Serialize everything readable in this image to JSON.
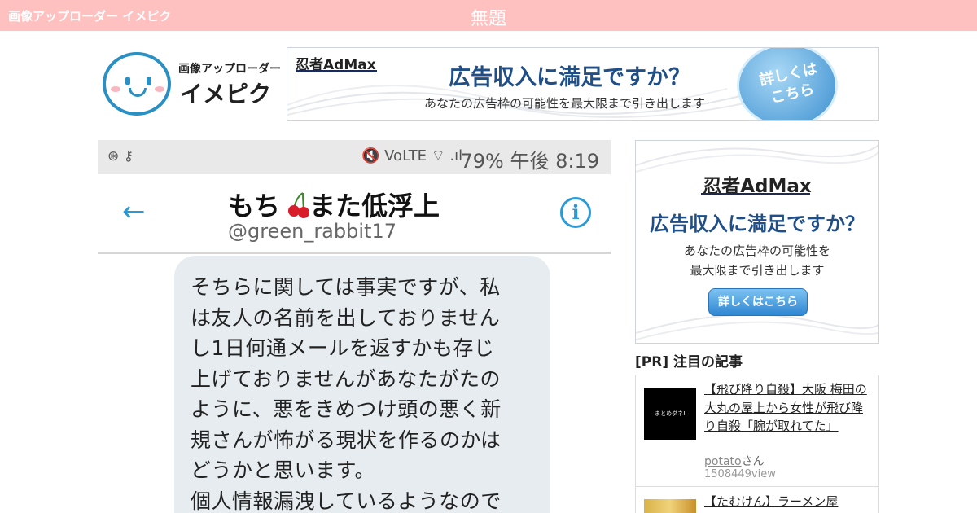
{
  "topbar": {
    "site_name": "画像アップローダー イメピク",
    "page_title": "無題"
  },
  "logo": {
    "subtitle": "画像アップローダー",
    "name": "イメピク"
  },
  "banner_top": {
    "brand": "忍者AdMax",
    "headline": "広告収入に満足ですか？",
    "subline": "あなたの広告枠の可能性を最大限まで引き出します",
    "circle_text": "詳しくは こちら"
  },
  "screenshot": {
    "status_right": "79% 午後 8:19",
    "status_symbols": "🔇 VoLTE ⌔ .ıl",
    "status_left": "⊛ ⚷",
    "display_name_pre": "もち",
    "display_name_post": "また低浮上",
    "handle": "@green_rabbit17",
    "message_lines": [
      "そちらに関しては事実ですが、私",
      "は友人の名前を出しておりません",
      "し1日何通メールを返すかも存じ",
      "上げておりませんがあなたがたの",
      "ように、悪をきめつけ頭の悪く新",
      "規さんが怖がる現状を作るのかは",
      "どうかと思います。",
      "個人情報漏洩しているようなので"
    ]
  },
  "sidebar_ad": {
    "brand": "忍者AdMax",
    "headline": "広告収入に満足ですか？",
    "line1": "あなたの広告枠の可能性を",
    "line2": "最大限まで引き出します",
    "button": "詳しくはこちら"
  },
  "pr": {
    "heading": "[PR] 注目の記事",
    "items": [
      {
        "thumb_text": "まとめダネ!",
        "title": "【飛び降り自殺】大阪 梅田の大丸の屋上から女性が飛び降り自殺「腕が取れてた」",
        "author": "potato",
        "author_suffix": "さん",
        "views": "1508449view"
      },
      {
        "title": "【たむけん】ラーメン屋"
      }
    ]
  }
}
